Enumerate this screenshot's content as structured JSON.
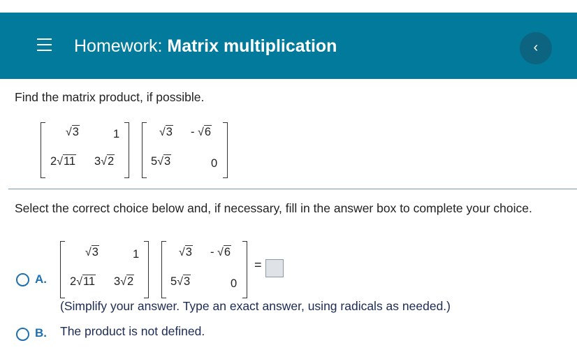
{
  "header": {
    "title_prefix": "Homework:",
    "title_name": "Matrix multiplication",
    "back_glyph": "‹",
    "menu_icon": "hamburger-icon",
    "accent_color": "#017a9c"
  },
  "question": {
    "prompt": "Find the matrix product, if possible.",
    "matrix_a": [
      [
        "3",
        "1"
      ],
      [
        "11",
        "2"
      ]
    ],
    "matrix_a_coef": [
      [
        "",
        ""
      ],
      [
        "2",
        "3"
      ]
    ],
    "matrix_b": [
      [
        "3",
        "6"
      ],
      [
        "3",
        "0"
      ]
    ],
    "matrix_b_coef": [
      [
        "",
        "-"
      ],
      [
        "5",
        ""
      ]
    ],
    "matrix_b_plain_zero": "0",
    "matrix_a_plain_one": "1"
  },
  "instruction": "Select the correct choice below and, if necessary, fill in the answer box to complete your choice.",
  "choices": {
    "a_label": "A.",
    "equals": "=",
    "a_note": "(Simplify your answer. Type an exact answer, using radicals as needed.)",
    "b_label": "B.",
    "b_text": "The product is not defined."
  }
}
